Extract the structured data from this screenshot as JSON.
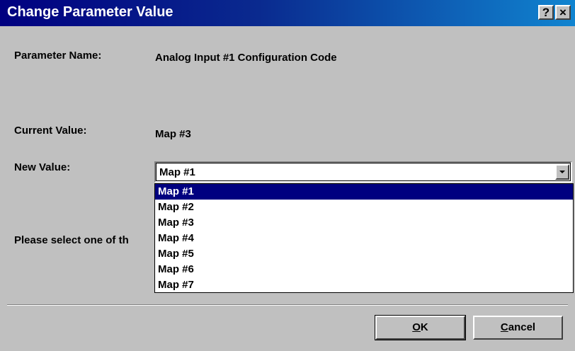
{
  "window": {
    "title": "Change Parameter Value",
    "help_label": "?",
    "close_label": "×"
  },
  "parameter": {
    "name_label": "Parameter Name:",
    "name_value": "Analog Input #1 Configuration Code",
    "current_label": "Current Value:",
    "current_value": "Map #3",
    "new_label": "New Value:",
    "new_value": "Map #1"
  },
  "prompt": {
    "text": "Please select one of th"
  },
  "dropdown": {
    "options": [
      "Map #1",
      "Map #2",
      "Map #3",
      "Map #4",
      "Map #5",
      "Map #6",
      "Map #7"
    ],
    "highlighted": "Map #1"
  },
  "buttons": {
    "ok_underlined": "O",
    "ok_rest": "K",
    "cancel_underlined": "C",
    "cancel_rest": "ancel"
  },
  "colors": {
    "title_gradient_start": "#000080",
    "title_gradient_end": "#1084d0",
    "dialog_background": "#c0c0c0",
    "selection": "#000080"
  }
}
